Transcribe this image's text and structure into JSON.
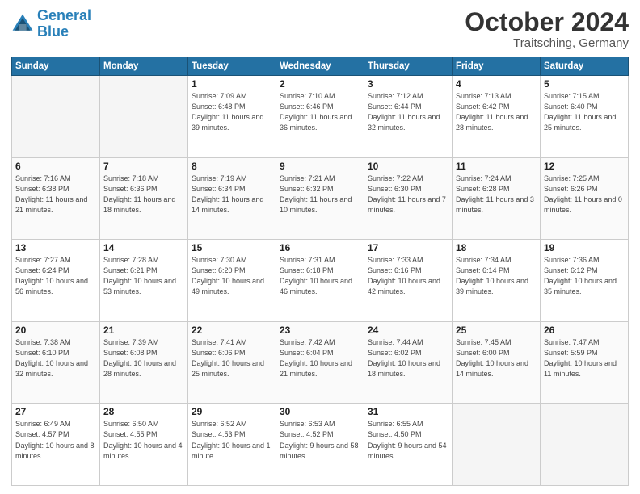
{
  "header": {
    "logo_general": "General",
    "logo_blue": "Blue",
    "month_title": "October 2024",
    "location": "Traitsching, Germany"
  },
  "days_of_week": [
    "Sunday",
    "Monday",
    "Tuesday",
    "Wednesday",
    "Thursday",
    "Friday",
    "Saturday"
  ],
  "weeks": [
    [
      {
        "day": "",
        "sunrise": "",
        "sunset": "",
        "daylight": ""
      },
      {
        "day": "",
        "sunrise": "",
        "sunset": "",
        "daylight": ""
      },
      {
        "day": "1",
        "sunrise": "Sunrise: 7:09 AM",
        "sunset": "Sunset: 6:48 PM",
        "daylight": "Daylight: 11 hours and 39 minutes."
      },
      {
        "day": "2",
        "sunrise": "Sunrise: 7:10 AM",
        "sunset": "Sunset: 6:46 PM",
        "daylight": "Daylight: 11 hours and 36 minutes."
      },
      {
        "day": "3",
        "sunrise": "Sunrise: 7:12 AM",
        "sunset": "Sunset: 6:44 PM",
        "daylight": "Daylight: 11 hours and 32 minutes."
      },
      {
        "day": "4",
        "sunrise": "Sunrise: 7:13 AM",
        "sunset": "Sunset: 6:42 PM",
        "daylight": "Daylight: 11 hours and 28 minutes."
      },
      {
        "day": "5",
        "sunrise": "Sunrise: 7:15 AM",
        "sunset": "Sunset: 6:40 PM",
        "daylight": "Daylight: 11 hours and 25 minutes."
      }
    ],
    [
      {
        "day": "6",
        "sunrise": "Sunrise: 7:16 AM",
        "sunset": "Sunset: 6:38 PM",
        "daylight": "Daylight: 11 hours and 21 minutes."
      },
      {
        "day": "7",
        "sunrise": "Sunrise: 7:18 AM",
        "sunset": "Sunset: 6:36 PM",
        "daylight": "Daylight: 11 hours and 18 minutes."
      },
      {
        "day": "8",
        "sunrise": "Sunrise: 7:19 AM",
        "sunset": "Sunset: 6:34 PM",
        "daylight": "Daylight: 11 hours and 14 minutes."
      },
      {
        "day": "9",
        "sunrise": "Sunrise: 7:21 AM",
        "sunset": "Sunset: 6:32 PM",
        "daylight": "Daylight: 11 hours and 10 minutes."
      },
      {
        "day": "10",
        "sunrise": "Sunrise: 7:22 AM",
        "sunset": "Sunset: 6:30 PM",
        "daylight": "Daylight: 11 hours and 7 minutes."
      },
      {
        "day": "11",
        "sunrise": "Sunrise: 7:24 AM",
        "sunset": "Sunset: 6:28 PM",
        "daylight": "Daylight: 11 hours and 3 minutes."
      },
      {
        "day": "12",
        "sunrise": "Sunrise: 7:25 AM",
        "sunset": "Sunset: 6:26 PM",
        "daylight": "Daylight: 11 hours and 0 minutes."
      }
    ],
    [
      {
        "day": "13",
        "sunrise": "Sunrise: 7:27 AM",
        "sunset": "Sunset: 6:24 PM",
        "daylight": "Daylight: 10 hours and 56 minutes."
      },
      {
        "day": "14",
        "sunrise": "Sunrise: 7:28 AM",
        "sunset": "Sunset: 6:21 PM",
        "daylight": "Daylight: 10 hours and 53 minutes."
      },
      {
        "day": "15",
        "sunrise": "Sunrise: 7:30 AM",
        "sunset": "Sunset: 6:20 PM",
        "daylight": "Daylight: 10 hours and 49 minutes."
      },
      {
        "day": "16",
        "sunrise": "Sunrise: 7:31 AM",
        "sunset": "Sunset: 6:18 PM",
        "daylight": "Daylight: 10 hours and 46 minutes."
      },
      {
        "day": "17",
        "sunrise": "Sunrise: 7:33 AM",
        "sunset": "Sunset: 6:16 PM",
        "daylight": "Daylight: 10 hours and 42 minutes."
      },
      {
        "day": "18",
        "sunrise": "Sunrise: 7:34 AM",
        "sunset": "Sunset: 6:14 PM",
        "daylight": "Daylight: 10 hours and 39 minutes."
      },
      {
        "day": "19",
        "sunrise": "Sunrise: 7:36 AM",
        "sunset": "Sunset: 6:12 PM",
        "daylight": "Daylight: 10 hours and 35 minutes."
      }
    ],
    [
      {
        "day": "20",
        "sunrise": "Sunrise: 7:38 AM",
        "sunset": "Sunset: 6:10 PM",
        "daylight": "Daylight: 10 hours and 32 minutes."
      },
      {
        "day": "21",
        "sunrise": "Sunrise: 7:39 AM",
        "sunset": "Sunset: 6:08 PM",
        "daylight": "Daylight: 10 hours and 28 minutes."
      },
      {
        "day": "22",
        "sunrise": "Sunrise: 7:41 AM",
        "sunset": "Sunset: 6:06 PM",
        "daylight": "Daylight: 10 hours and 25 minutes."
      },
      {
        "day": "23",
        "sunrise": "Sunrise: 7:42 AM",
        "sunset": "Sunset: 6:04 PM",
        "daylight": "Daylight: 10 hours and 21 minutes."
      },
      {
        "day": "24",
        "sunrise": "Sunrise: 7:44 AM",
        "sunset": "Sunset: 6:02 PM",
        "daylight": "Daylight: 10 hours and 18 minutes."
      },
      {
        "day": "25",
        "sunrise": "Sunrise: 7:45 AM",
        "sunset": "Sunset: 6:00 PM",
        "daylight": "Daylight: 10 hours and 14 minutes."
      },
      {
        "day": "26",
        "sunrise": "Sunrise: 7:47 AM",
        "sunset": "Sunset: 5:59 PM",
        "daylight": "Daylight: 10 hours and 11 minutes."
      }
    ],
    [
      {
        "day": "27",
        "sunrise": "Sunrise: 6:49 AM",
        "sunset": "Sunset: 4:57 PM",
        "daylight": "Daylight: 10 hours and 8 minutes."
      },
      {
        "day": "28",
        "sunrise": "Sunrise: 6:50 AM",
        "sunset": "Sunset: 4:55 PM",
        "daylight": "Daylight: 10 hours and 4 minutes."
      },
      {
        "day": "29",
        "sunrise": "Sunrise: 6:52 AM",
        "sunset": "Sunset: 4:53 PM",
        "daylight": "Daylight: 10 hours and 1 minute."
      },
      {
        "day": "30",
        "sunrise": "Sunrise: 6:53 AM",
        "sunset": "Sunset: 4:52 PM",
        "daylight": "Daylight: 9 hours and 58 minutes."
      },
      {
        "day": "31",
        "sunrise": "Sunrise: 6:55 AM",
        "sunset": "Sunset: 4:50 PM",
        "daylight": "Daylight: 9 hours and 54 minutes."
      },
      {
        "day": "",
        "sunrise": "",
        "sunset": "",
        "daylight": ""
      },
      {
        "day": "",
        "sunrise": "",
        "sunset": "",
        "daylight": ""
      }
    ]
  ]
}
